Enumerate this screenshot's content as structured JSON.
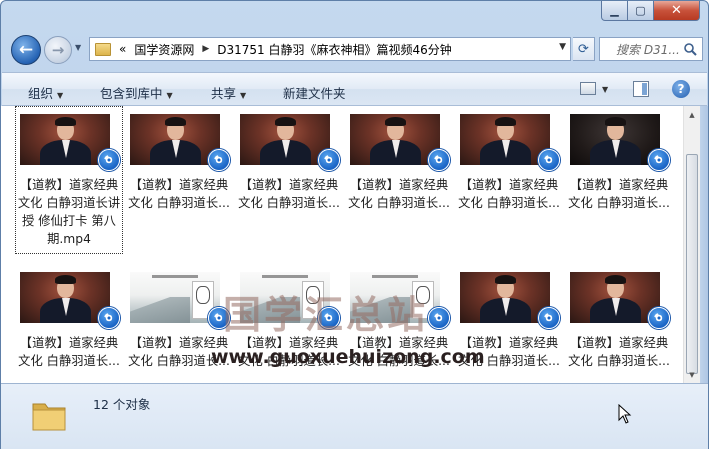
{
  "address": {
    "overflow": "«",
    "parts": [
      "国学资源网",
      "D31751 白静羽《麻衣神相》篇视频46分钟"
    ]
  },
  "search": {
    "placeholder": "搜索 D31..."
  },
  "commands": {
    "organize": "组织",
    "include_in_library": "包含到库中",
    "share": "共享",
    "new_folder": "新建文件夹"
  },
  "items": [
    {
      "label": "【道教】道家经典文化 白静羽道长讲授 修仙打卡 第八期.mp4",
      "thumb": "portrait",
      "focused": true
    },
    {
      "label": "【道教】道家经典文化 白静羽道长...",
      "thumb": "portrait"
    },
    {
      "label": "【道教】道家经典文化 白静羽道长...",
      "thumb": "portrait"
    },
    {
      "label": "【道教】道家经典文化 白静羽道长...",
      "thumb": "portrait"
    },
    {
      "label": "【道教】道家经典文化 白静羽道长...",
      "thumb": "portrait"
    },
    {
      "label": "【道教】道家经典文化 白静羽道长...",
      "thumb": "portrait-dark"
    },
    {
      "label": "【道教】道家经典文化 白静羽道长...",
      "thumb": "portrait"
    },
    {
      "label": "【道教】道家经典文化 白静羽道长...",
      "thumb": "slide"
    },
    {
      "label": "【道教】道家经典文化 白静羽道长...",
      "thumb": "slide"
    },
    {
      "label": "【道教】道家经典文化 白静羽道长...",
      "thumb": "slide"
    },
    {
      "label": "【道教】道家经典文化 白静羽道长...",
      "thumb": "portrait"
    },
    {
      "label": "【道教】道家经典文化 白静羽道长...",
      "thumb": "portrait"
    }
  ],
  "watermark": {
    "title": "国学汇总站",
    "url": "www.guoxuehuizong.com"
  },
  "details": {
    "count_text": "12 个对象"
  },
  "colors": {
    "frame": "#b7cde8",
    "accent": "#1a64c5"
  }
}
